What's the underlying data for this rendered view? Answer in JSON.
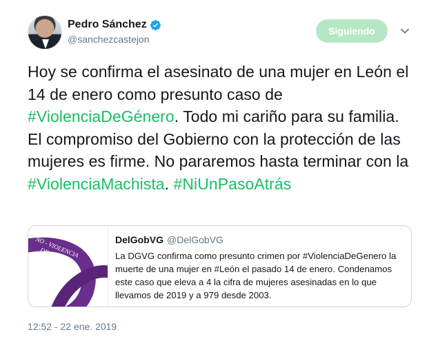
{
  "author": {
    "display_name": "Pedro Sánchez",
    "handle": "@sanchezcastejon"
  },
  "follow_button_label": "Siguiendo",
  "tweet": {
    "segments": [
      {
        "text": "Hoy se confirma el asesinato de una mujer en León el 14 de enero como presunto caso de ",
        "hashtag": false
      },
      {
        "text": "#ViolenciaDeGénero",
        "hashtag": true
      },
      {
        "text": ". Todo mi cariño para su familia. El compromiso del Gobierno con la protección de las mujeres es firme. No pararemos hasta terminar con la ",
        "hashtag": false
      },
      {
        "text": "#ViolenciaMachista",
        "hashtag": true
      },
      {
        "text": ". ",
        "hashtag": false
      },
      {
        "text": "#NiUnPasoAtrás",
        "hashtag": true
      }
    ]
  },
  "quoted": {
    "display_name": "DelGobVG",
    "handle": "@DelGobVG",
    "text": "La DGVG confirma como presunto crimen por #ViolenciaDeGenero la muerte de una mujer en #León el pasado 14 de enero. Condenamos este caso que eleva a 4 la cifra de mujeres asesinadas en lo que llevamos de 2019 y a 979 desde 2003.",
    "image_text_line1": "NO - VIOLENCIA",
    "image_text_line2": "DE GÉNERO"
  },
  "timestamp": "12:52 - 22 ene. 2019",
  "colors": {
    "hashtag": "#17bf63",
    "follow_button": "#b6e7c5",
    "verified": "#1da1f2",
    "ribbon": "#6a2f8c"
  }
}
